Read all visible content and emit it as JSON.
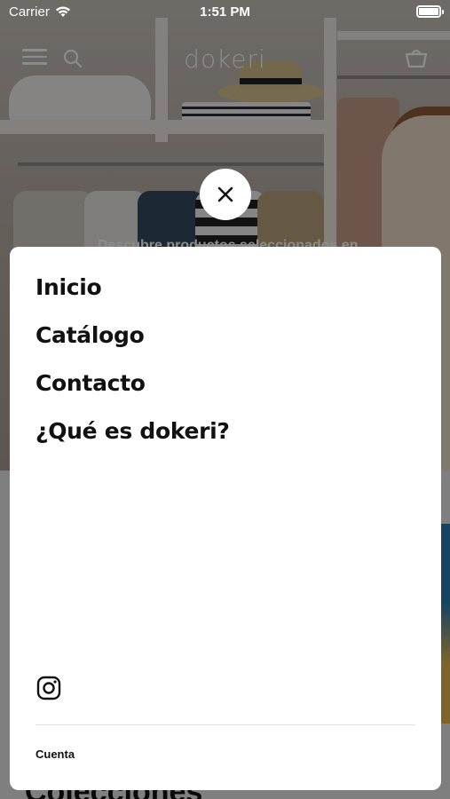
{
  "status_bar": {
    "carrier": "Carrier",
    "time": "1:51 PM"
  },
  "header": {
    "brand": "dokeri",
    "icons": [
      "menu-icon",
      "search-icon",
      "cart-icon"
    ]
  },
  "hero": {
    "text": "Descubre productos seleccionados en"
  },
  "below": {
    "section_title": "Colecciones"
  },
  "menu": {
    "close_icon": "close-icon",
    "items": [
      {
        "label": "Inicio"
      },
      {
        "label": "Catálogo"
      },
      {
        "label": "Contacto"
      },
      {
        "label": "¿Qué es dokeri?"
      }
    ],
    "social_icon": "instagram-icon",
    "account_label": "Cuenta"
  },
  "colors": {
    "sheet": "#ffffff",
    "overlay": "rgba(0,0,0,0.45)",
    "text": "#111111"
  }
}
